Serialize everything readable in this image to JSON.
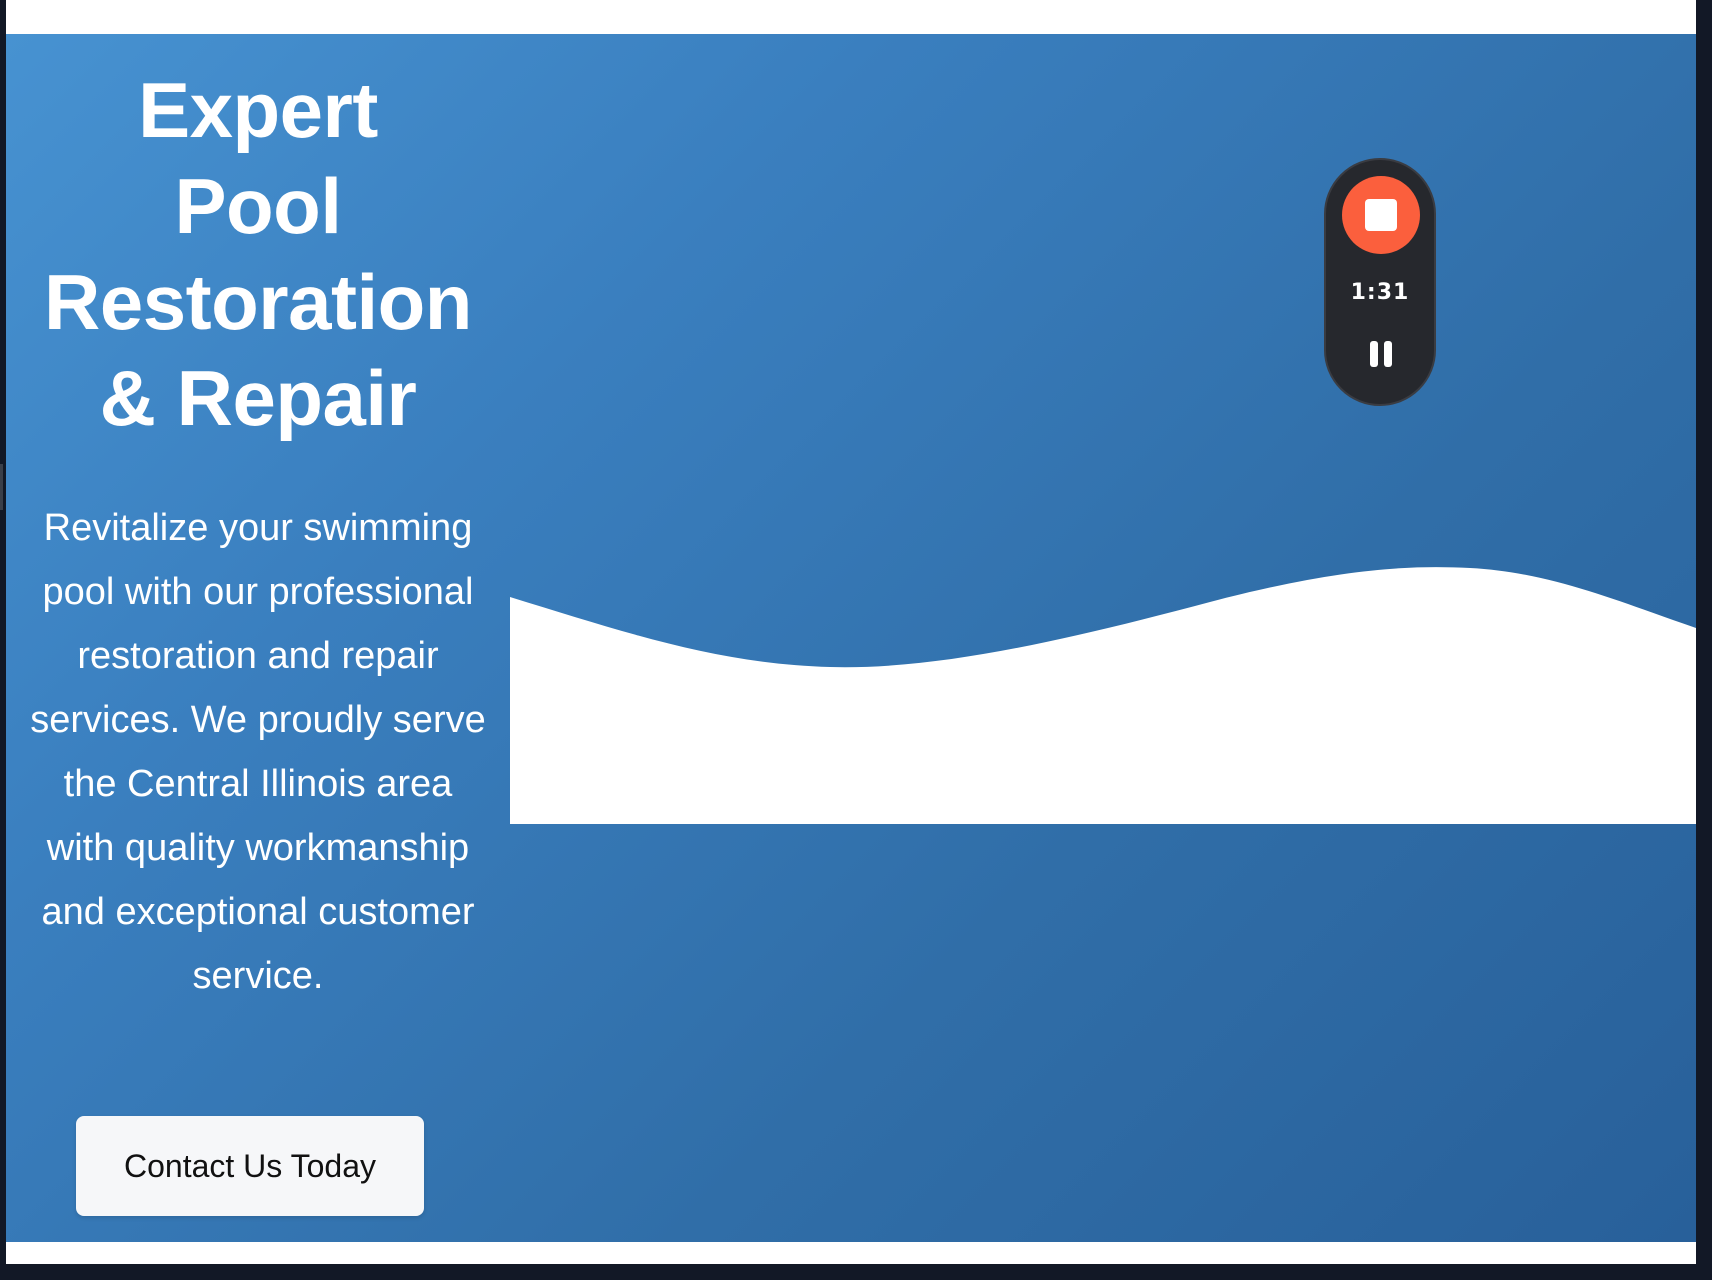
{
  "hero": {
    "headline_lines": [
      "Expert",
      "Pool",
      "Restoration",
      "& Repair"
    ],
    "description": "Revitalize your swimming pool with our professional restoration and repair services. We proudly serve the Central Illinois area with quality workmanship and exceptional customer service.",
    "cta_label": "Contact Us Today"
  },
  "recorder": {
    "elapsed": "1:31",
    "stop_icon": "stop-icon",
    "pause_icon": "pause-icon"
  },
  "colors": {
    "hero_gradient_start": "#4792d1",
    "hero_gradient_end": "#28609a",
    "record_accent": "#fb5f3d",
    "recorder_bg": "#26282d",
    "cta_bg": "#f6f7f9"
  }
}
